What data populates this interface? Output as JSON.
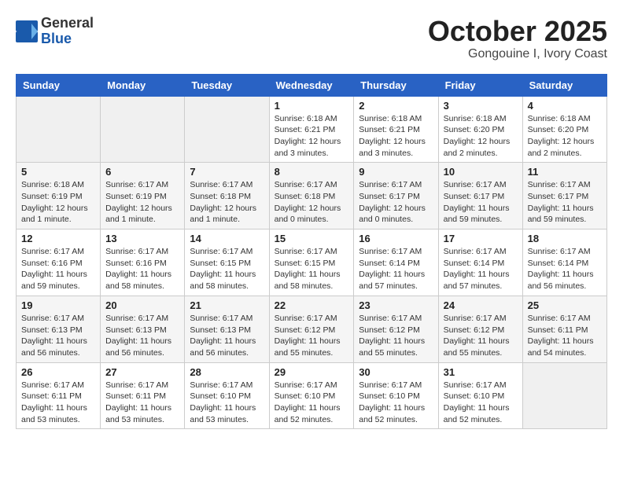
{
  "header": {
    "logo_general": "General",
    "logo_blue": "Blue",
    "month_title": "October 2025",
    "location": "Gongouine I, Ivory Coast"
  },
  "days_of_week": [
    "Sunday",
    "Monday",
    "Tuesday",
    "Wednesday",
    "Thursday",
    "Friday",
    "Saturday"
  ],
  "weeks": [
    [
      {
        "day": "",
        "info": ""
      },
      {
        "day": "",
        "info": ""
      },
      {
        "day": "",
        "info": ""
      },
      {
        "day": "1",
        "info": "Sunrise: 6:18 AM\nSunset: 6:21 PM\nDaylight: 12 hours and 3 minutes."
      },
      {
        "day": "2",
        "info": "Sunrise: 6:18 AM\nSunset: 6:21 PM\nDaylight: 12 hours and 3 minutes."
      },
      {
        "day": "3",
        "info": "Sunrise: 6:18 AM\nSunset: 6:20 PM\nDaylight: 12 hours and 2 minutes."
      },
      {
        "day": "4",
        "info": "Sunrise: 6:18 AM\nSunset: 6:20 PM\nDaylight: 12 hours and 2 minutes."
      }
    ],
    [
      {
        "day": "5",
        "info": "Sunrise: 6:18 AM\nSunset: 6:19 PM\nDaylight: 12 hours and 1 minute."
      },
      {
        "day": "6",
        "info": "Sunrise: 6:17 AM\nSunset: 6:19 PM\nDaylight: 12 hours and 1 minute."
      },
      {
        "day": "7",
        "info": "Sunrise: 6:17 AM\nSunset: 6:18 PM\nDaylight: 12 hours and 1 minute."
      },
      {
        "day": "8",
        "info": "Sunrise: 6:17 AM\nSunset: 6:18 PM\nDaylight: 12 hours and 0 minutes."
      },
      {
        "day": "9",
        "info": "Sunrise: 6:17 AM\nSunset: 6:17 PM\nDaylight: 12 hours and 0 minutes."
      },
      {
        "day": "10",
        "info": "Sunrise: 6:17 AM\nSunset: 6:17 PM\nDaylight: 11 hours and 59 minutes."
      },
      {
        "day": "11",
        "info": "Sunrise: 6:17 AM\nSunset: 6:17 PM\nDaylight: 11 hours and 59 minutes."
      }
    ],
    [
      {
        "day": "12",
        "info": "Sunrise: 6:17 AM\nSunset: 6:16 PM\nDaylight: 11 hours and 59 minutes."
      },
      {
        "day": "13",
        "info": "Sunrise: 6:17 AM\nSunset: 6:16 PM\nDaylight: 11 hours and 58 minutes."
      },
      {
        "day": "14",
        "info": "Sunrise: 6:17 AM\nSunset: 6:15 PM\nDaylight: 11 hours and 58 minutes."
      },
      {
        "day": "15",
        "info": "Sunrise: 6:17 AM\nSunset: 6:15 PM\nDaylight: 11 hours and 58 minutes."
      },
      {
        "day": "16",
        "info": "Sunrise: 6:17 AM\nSunset: 6:14 PM\nDaylight: 11 hours and 57 minutes."
      },
      {
        "day": "17",
        "info": "Sunrise: 6:17 AM\nSunset: 6:14 PM\nDaylight: 11 hours and 57 minutes."
      },
      {
        "day": "18",
        "info": "Sunrise: 6:17 AM\nSunset: 6:14 PM\nDaylight: 11 hours and 56 minutes."
      }
    ],
    [
      {
        "day": "19",
        "info": "Sunrise: 6:17 AM\nSunset: 6:13 PM\nDaylight: 11 hours and 56 minutes."
      },
      {
        "day": "20",
        "info": "Sunrise: 6:17 AM\nSunset: 6:13 PM\nDaylight: 11 hours and 56 minutes."
      },
      {
        "day": "21",
        "info": "Sunrise: 6:17 AM\nSunset: 6:13 PM\nDaylight: 11 hours and 56 minutes."
      },
      {
        "day": "22",
        "info": "Sunrise: 6:17 AM\nSunset: 6:12 PM\nDaylight: 11 hours and 55 minutes."
      },
      {
        "day": "23",
        "info": "Sunrise: 6:17 AM\nSunset: 6:12 PM\nDaylight: 11 hours and 55 minutes."
      },
      {
        "day": "24",
        "info": "Sunrise: 6:17 AM\nSunset: 6:12 PM\nDaylight: 11 hours and 55 minutes."
      },
      {
        "day": "25",
        "info": "Sunrise: 6:17 AM\nSunset: 6:11 PM\nDaylight: 11 hours and 54 minutes."
      }
    ],
    [
      {
        "day": "26",
        "info": "Sunrise: 6:17 AM\nSunset: 6:11 PM\nDaylight: 11 hours and 53 minutes."
      },
      {
        "day": "27",
        "info": "Sunrise: 6:17 AM\nSunset: 6:11 PM\nDaylight: 11 hours and 53 minutes."
      },
      {
        "day": "28",
        "info": "Sunrise: 6:17 AM\nSunset: 6:10 PM\nDaylight: 11 hours and 53 minutes."
      },
      {
        "day": "29",
        "info": "Sunrise: 6:17 AM\nSunset: 6:10 PM\nDaylight: 11 hours and 52 minutes."
      },
      {
        "day": "30",
        "info": "Sunrise: 6:17 AM\nSunset: 6:10 PM\nDaylight: 11 hours and 52 minutes."
      },
      {
        "day": "31",
        "info": "Sunrise: 6:17 AM\nSunset: 6:10 PM\nDaylight: 11 hours and 52 minutes."
      },
      {
        "day": "",
        "info": ""
      }
    ]
  ]
}
